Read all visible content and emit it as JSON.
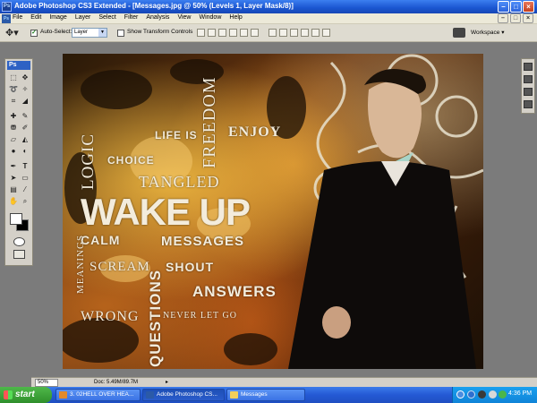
{
  "window": {
    "title": "Adobe Photoshop CS3 Extended - [Messages.jpg @ 50% (Levels 1, Layer Mask/8)]",
    "app_icon_text": "Ps"
  },
  "menu": {
    "items": [
      "File",
      "Edit",
      "Image",
      "Layer",
      "Select",
      "Filter",
      "Analysis",
      "View",
      "Window",
      "Help"
    ]
  },
  "options": {
    "auto_select_label": "Auto-Select:",
    "auto_select_value": "Layer",
    "transform_label": "Show Transform Controls",
    "workspace_label": "Workspace"
  },
  "toolbox": {
    "logo": "Ps"
  },
  "canvas": {
    "words": {
      "freedom": "FREEDOM",
      "logic": "LOGIC",
      "life_is": "LIFE IS",
      "enjoy": "ENJOY",
      "choice": "CHOICE",
      "tangled": "TANGLED",
      "wake_up": "WAKE UP",
      "calm": "CALM",
      "messages": "MESSAGES",
      "meanings": "MEANINGS",
      "scream": "SCREAM",
      "shout": "SHOUT",
      "questions": "QUESTIONS",
      "answers": "ANSWERS",
      "wrong": "WRONG",
      "never_let_go": "NEVER LET GO"
    }
  },
  "status": {
    "zoom": "50%",
    "doc": "Doc: 5.49M/89.7M"
  },
  "taskbar": {
    "start": "start",
    "tasks": [
      "3. 02HELL OVER HEA...",
      "Adobe Photoshop CS...",
      "Messages"
    ],
    "clock": "4:36 PM"
  }
}
